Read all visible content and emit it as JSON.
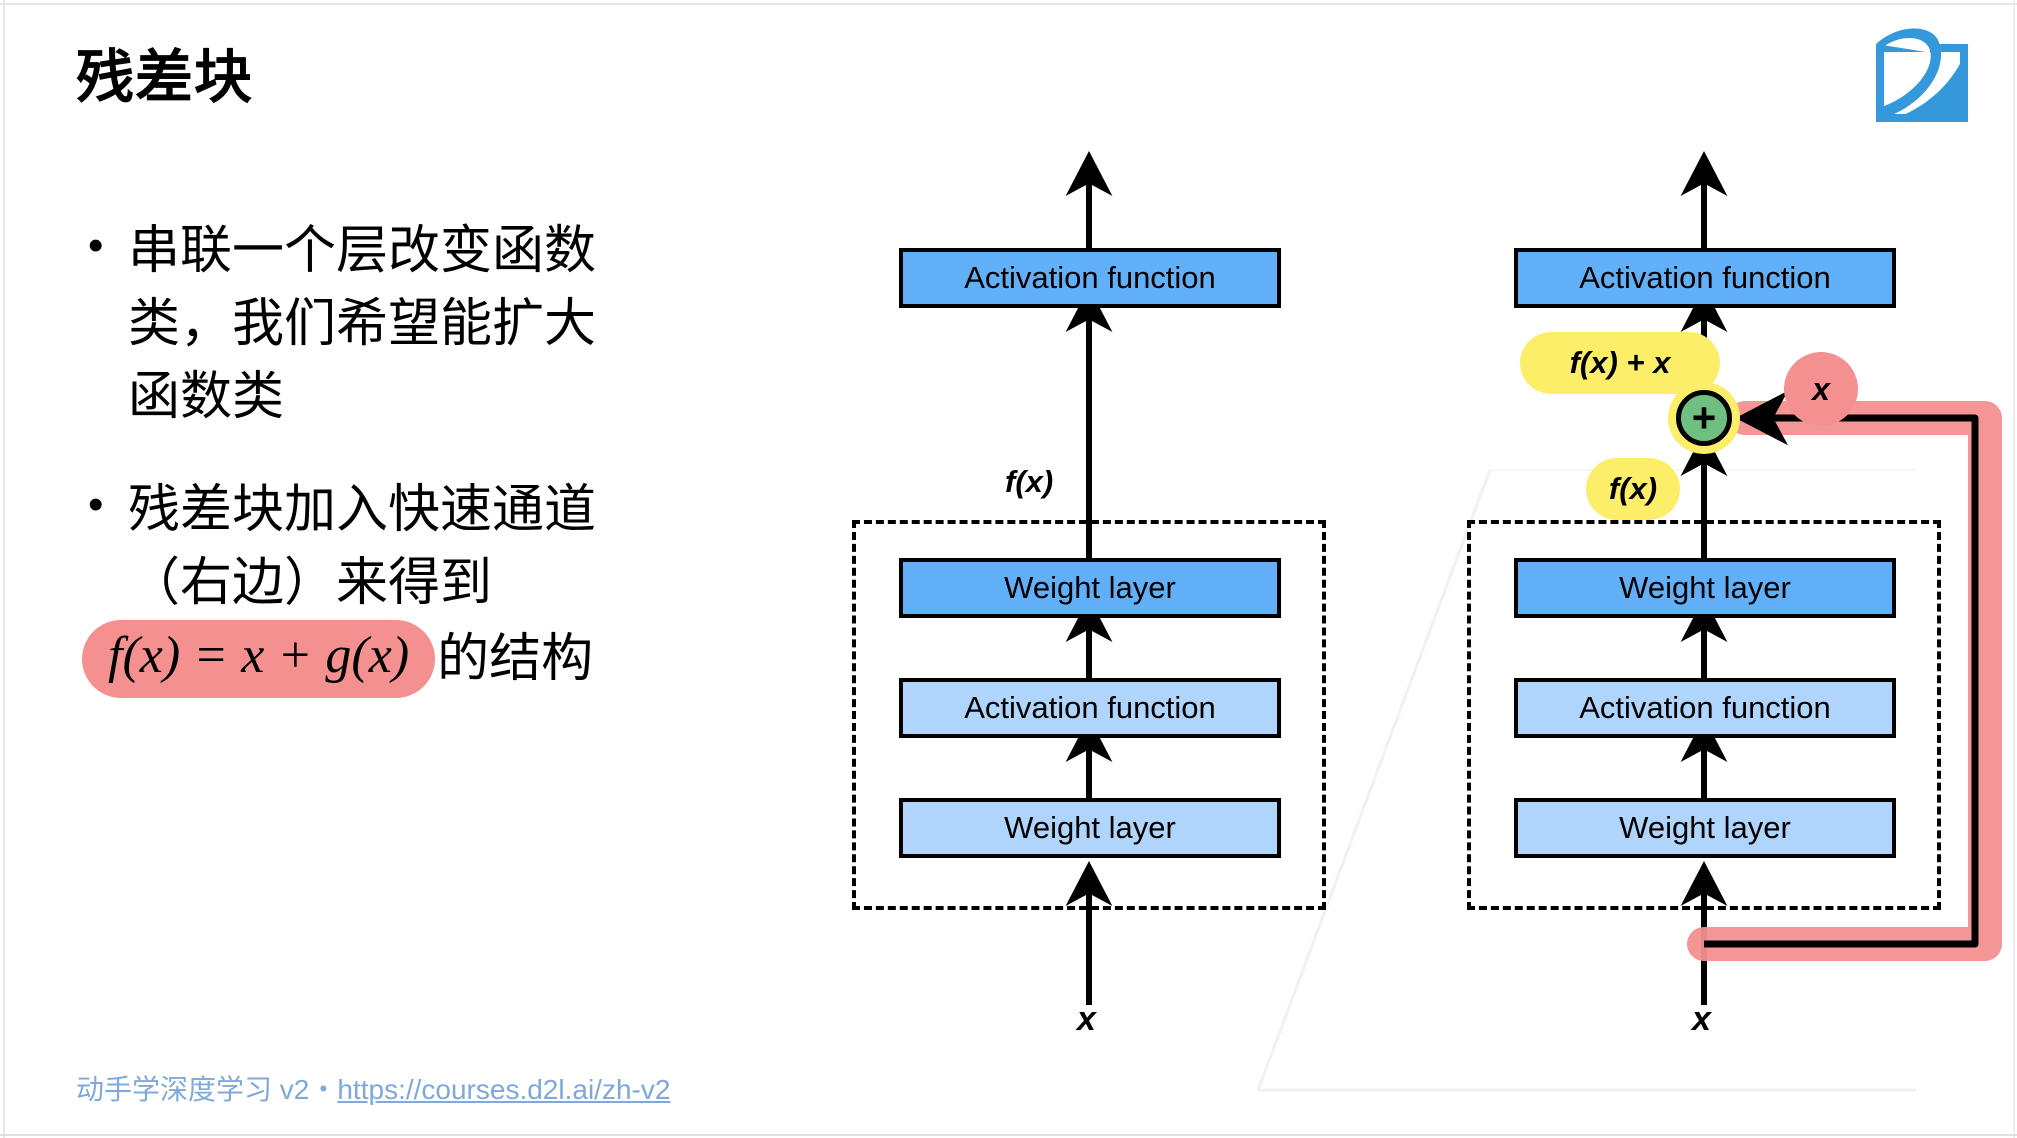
{
  "slide": {
    "title": "残差块",
    "logo_name": "d2l-logo",
    "background": "#ffffff"
  },
  "bullets": [
    {
      "marker": "•",
      "lines": [
        "串联一个层改变函数",
        "类，我们希望能扩大",
        "函数类"
      ]
    },
    {
      "marker": "•",
      "lines": [
        "残差块加入快速通道",
        "（右边）来得到"
      ],
      "formula": "f(x) = x + g(x)",
      "formula_tail": "的结构",
      "formula_highlight_color": "#F49090"
    }
  ],
  "diagram": {
    "left_block": {
      "caption_fx": "f(x)",
      "input_label": "x",
      "boxes": [
        {
          "label": "Activation function",
          "shade": "dark"
        },
        {
          "label": "Weight layer",
          "shade": "dark"
        },
        {
          "label": "Activation function",
          "shade": "light"
        },
        {
          "label": "Weight layer",
          "shade": "light"
        }
      ]
    },
    "right_block": {
      "caption_sum": "f(x) + x",
      "caption_fx": "f(x)",
      "shortcut_label": "x",
      "input_label": "x",
      "plus_symbol": "+",
      "boxes": [
        {
          "label": "Activation function",
          "shade": "dark"
        },
        {
          "label": "Weight layer",
          "shade": "dark"
        },
        {
          "label": "Activation function",
          "shade": "light"
        },
        {
          "label": "Weight layer",
          "shade": "light"
        }
      ]
    },
    "colors": {
      "box_dark": "#61B0F7",
      "box_light": "#AFD5FC",
      "plus_circle": "#6FBF80",
      "highlight_yellow": "#FCEE68",
      "shortcut_pink": "#F49090",
      "stroke": "#000000"
    }
  },
  "footer": {
    "text_prefix": "动手学深度学习 v2・",
    "link": "https://courses.d2l.ai/zh-v2",
    "color": "#7FA8DC"
  }
}
